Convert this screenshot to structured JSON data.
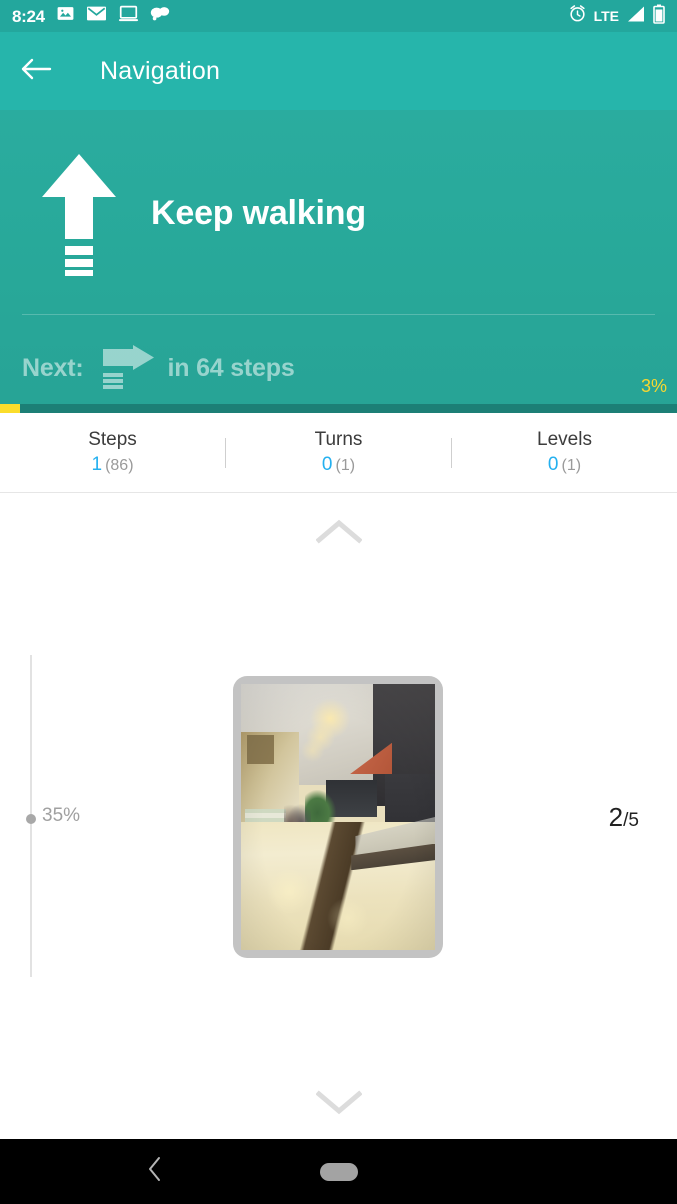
{
  "status_bar": {
    "time": "8:24",
    "network": "LTE",
    "left_icons": [
      "image-icon",
      "email-icon",
      "cast-screen-icon",
      "chat-bubbles-icon"
    ],
    "right_icons": [
      "alarm-icon",
      "signal-icon",
      "battery-icon"
    ]
  },
  "app_bar": {
    "title": "Navigation",
    "back_icon": "back-arrow-icon"
  },
  "instruction": {
    "primary_text": "Keep walking",
    "primary_icon": "straight-arrow-icon",
    "next_label": "Next:",
    "next_icon": "turn-right-icon",
    "next_distance": "in 64 steps",
    "progress_percent_label": "3%",
    "progress_percent_value": 3,
    "progress_fill_color": "#fbdd2b",
    "progress_track_color": "#1c7f76",
    "panel_color": "#28a899"
  },
  "stats": {
    "items": [
      {
        "label": "Steps",
        "current": "1",
        "total": "(86)"
      },
      {
        "label": "Turns",
        "current": "0",
        "total": "(1)"
      },
      {
        "label": "Levels",
        "current": "0",
        "total": "(1)"
      }
    ],
    "current_color": "#24b0ef",
    "total_color": "#9a9a9a"
  },
  "carousel": {
    "chevron_up_icon": "chevron-up-icon",
    "chevron_down_icon": "chevron-down-icon",
    "slider_label": "35%",
    "slider_value": 35,
    "page_current": "2",
    "page_total": "/5",
    "photo_alt": "mall-corridor-photo"
  },
  "nav_bar": {
    "back_icon": "nav-back-icon",
    "home_icon": "nav-home-pill"
  }
}
